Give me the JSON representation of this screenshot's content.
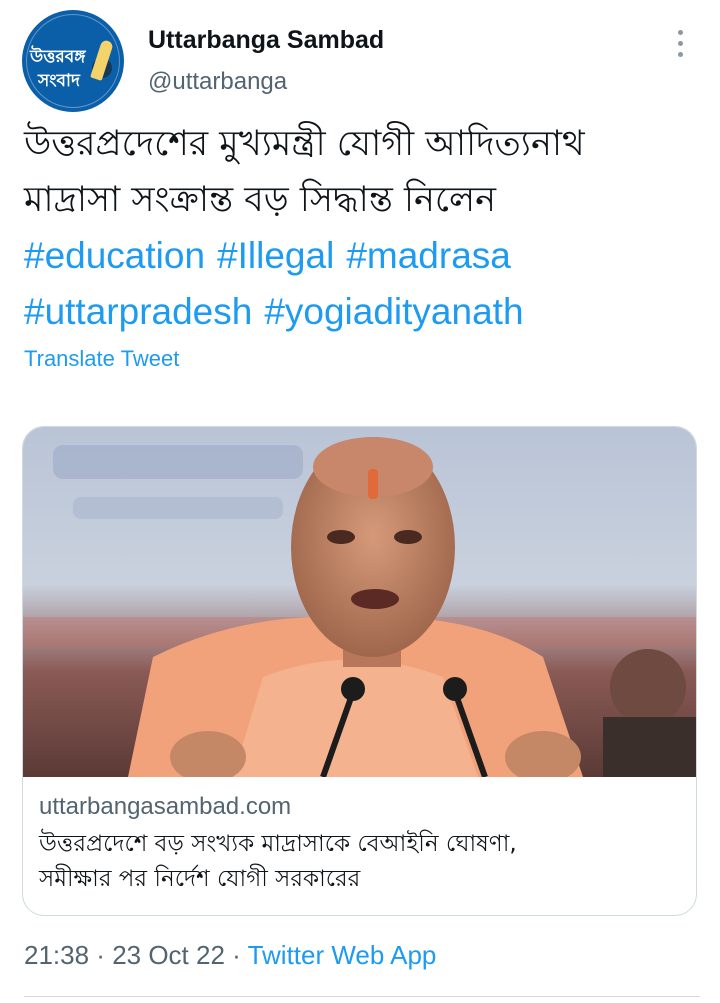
{
  "tweet": {
    "author_name": "Uttarbanga Sambad",
    "author_handle": "@uttarbanga",
    "avatar_logo_text": [
      "উত্তরবঙ্গ",
      "সংবাদ"
    ],
    "text_lines": [
      "উত্তরপ্রদেশের মুখ্যমন্ত্রী যোগী আদিত্যনাথ",
      "মাদ্রাসা সংক্রান্ত বড় সিদ্ধান্ত নিলেন"
    ],
    "hashtags": [
      "#education",
      "#Illegal",
      "#madrasa",
      "#uttarpradesh",
      "#yogiadityanath"
    ],
    "translate_label": "Translate Tweet",
    "card": {
      "domain": "uttarbangasambad.com",
      "title_lines": [
        "উত্তরপ্রদেশে বড় সংখ্যক মাদ্রাসাকে বেআইনি ঘোষণা,",
        "সমীক্ষার পর নির্দেশ যোগী সরকারের"
      ]
    },
    "time": "21:38",
    "separator": " · ",
    "date": "23 Oct 22",
    "source": "Twitter Web App"
  },
  "colors": {
    "link": "#1d9bf0",
    "secondary_text": "#536471",
    "primary_text": "#0f1419",
    "avatar_bg": "#0b5fa8"
  },
  "icons": {
    "more": "more-vertical-icon"
  }
}
